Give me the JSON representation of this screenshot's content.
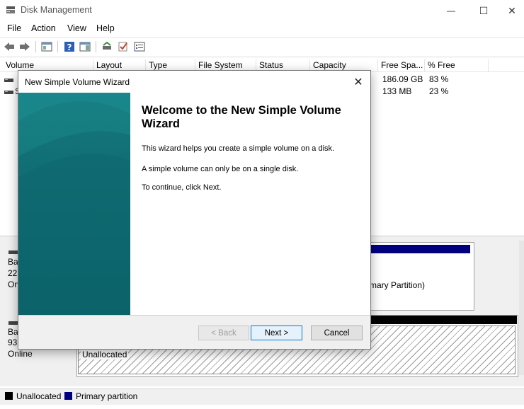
{
  "window": {
    "title": "Disk Management",
    "minimize": "—",
    "maximize": "☐",
    "close": "✕"
  },
  "menu": [
    "File",
    "Action",
    "View",
    "Help"
  ],
  "columns": [
    "Volume",
    "Layout",
    "Type",
    "File System",
    "Status",
    "Capacity",
    "Free Spa...",
    "% Free"
  ],
  "rows": [
    {
      "volume": "",
      "free": "186.09 GB",
      "pct": "83 %"
    },
    {
      "volume": "S",
      "free": "133 MB",
      "pct": "23 %"
    }
  ],
  "disks": [
    {
      "name": "Ba",
      "size": "22",
      "status": "On"
    },
    {
      "name": "Ba",
      "size": "93",
      "status": "Online"
    }
  ],
  "partition_text": "mary Partition)",
  "unallocated_label": "Unallocated",
  "legend": {
    "unallocated": "Unallocated",
    "primary": "Primary partition"
  },
  "colors": {
    "unallocated": "#000000",
    "primary": "#00007f",
    "banner": "#13737a"
  },
  "wizard": {
    "title": "New Simple Volume Wizard",
    "close": "✕",
    "heading": "Welcome to the New Simple Volume Wizard",
    "line1": "This wizard helps you create a simple volume on a disk.",
    "line2": "A simple volume can only be on a single disk.",
    "line3": "To continue, click Next.",
    "back": "< Back",
    "next": "Next >",
    "cancel": "Cancel"
  }
}
